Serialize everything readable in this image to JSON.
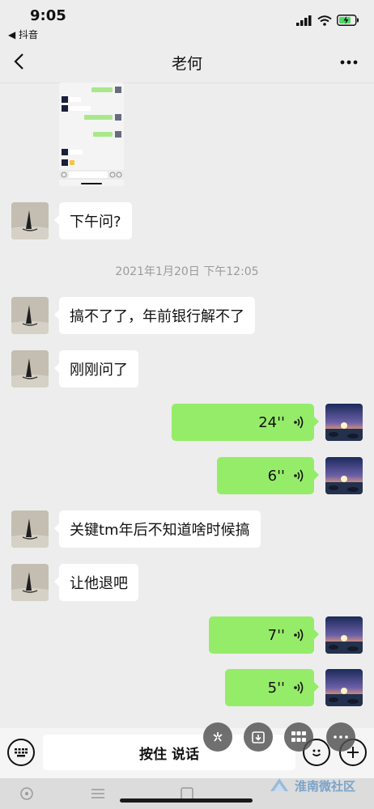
{
  "status_bar": {
    "time": "9:05",
    "back_app": "◀ 抖音"
  },
  "nav": {
    "title": "老何"
  },
  "timestamp": "2021年1月20日 下午12:05",
  "messages": [
    {
      "text": "下午问?"
    },
    {
      "text": "搞不了了，年前银行解不了"
    },
    {
      "text": "刚刚问了"
    },
    {
      "duration": "24''"
    },
    {
      "duration": "6''"
    },
    {
      "text": "关键tm年后不知道啥时候搞"
    },
    {
      "text": "让他退吧"
    },
    {
      "duration": "7''"
    },
    {
      "duration": "5''"
    }
  ],
  "input": {
    "hold_to_talk": "按住 说话"
  },
  "watermark": "淮南微社区",
  "colors": {
    "background": "#ededed",
    "outgoing_bubble": "#95ec69",
    "incoming_bubble": "#ffffff"
  }
}
